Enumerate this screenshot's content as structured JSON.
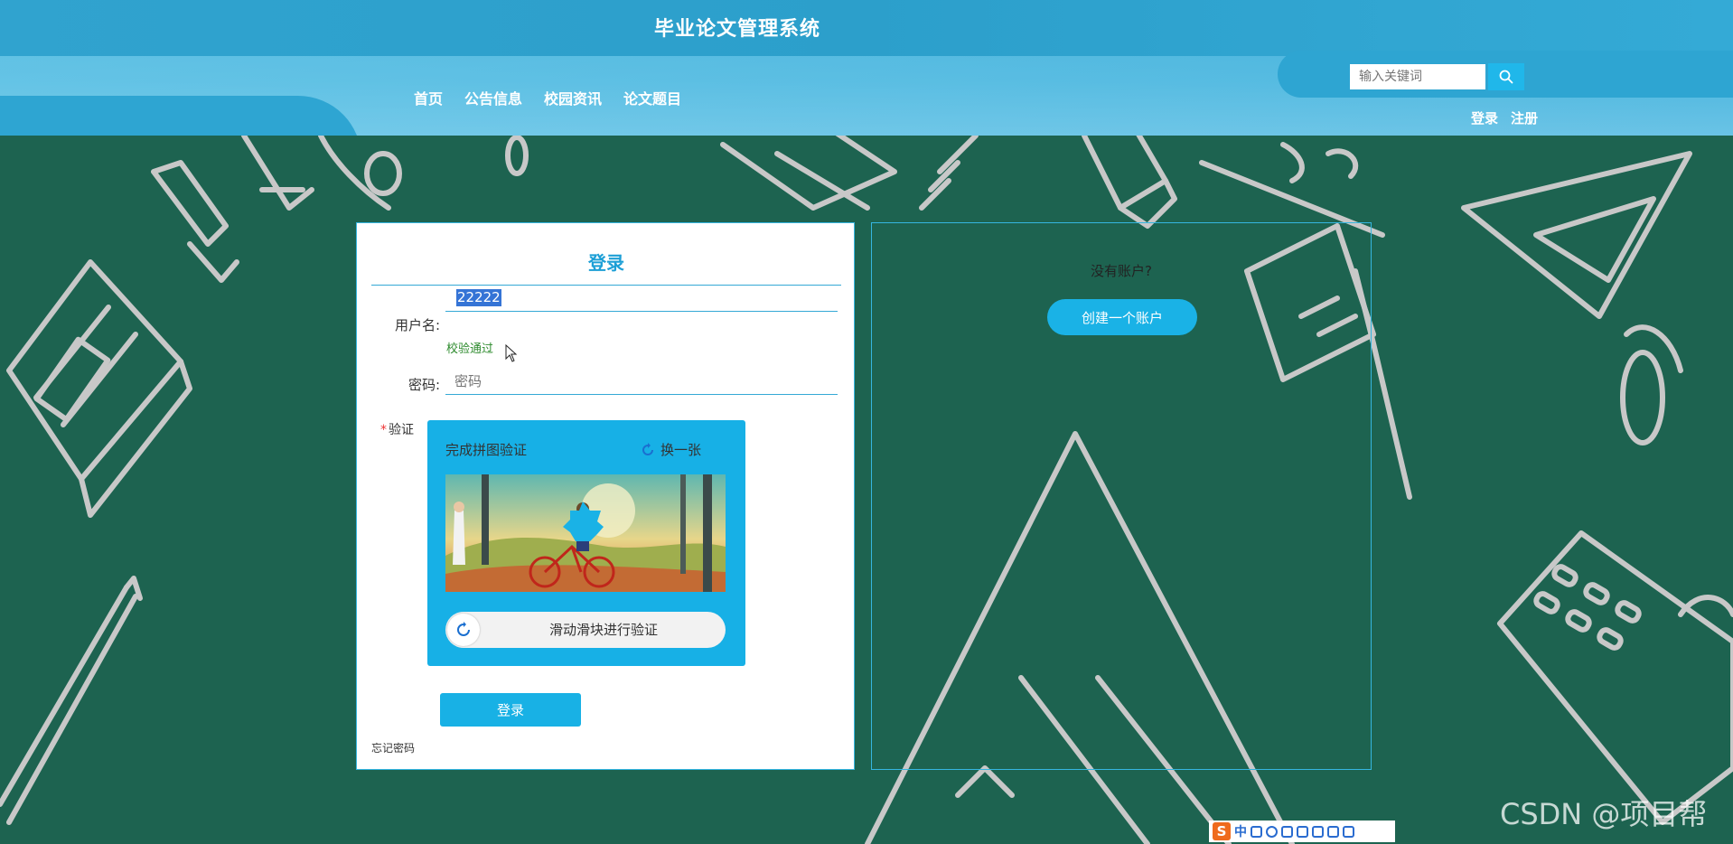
{
  "header": {
    "site_title": "毕业论文管理系统",
    "nav": [
      "首页",
      "公告信息",
      "校园资讯",
      "论文题目"
    ],
    "search_placeholder": "输入关键词",
    "login_link": "登录",
    "register_link": "注册"
  },
  "login": {
    "title": "登录",
    "username_label": "用户名:",
    "username_value": "22222",
    "username_valid_msg": "校验通过",
    "password_label": "密码:",
    "password_placeholder": "密码",
    "verify_label": "验证",
    "captcha": {
      "title": "完成拼图验证",
      "refresh_label": "换一张",
      "slider_text": "滑动滑块进行验证"
    },
    "submit_label": "登录",
    "forgot_label": "忘记密码"
  },
  "register": {
    "prompt": "没有账户?",
    "create_label": "创建一个账户"
  },
  "ime": {
    "logo": "S",
    "mode": "中"
  },
  "watermark": "CSDN @项目帮",
  "colors": {
    "accent": "#18b1e5",
    "board": "#1d6350",
    "header": "#34a9d6",
    "valid": "#2e8b2e"
  },
  "icons": {
    "search": "search-icon",
    "refresh": "refresh-icon",
    "slider": "refresh-arrow-icon"
  }
}
